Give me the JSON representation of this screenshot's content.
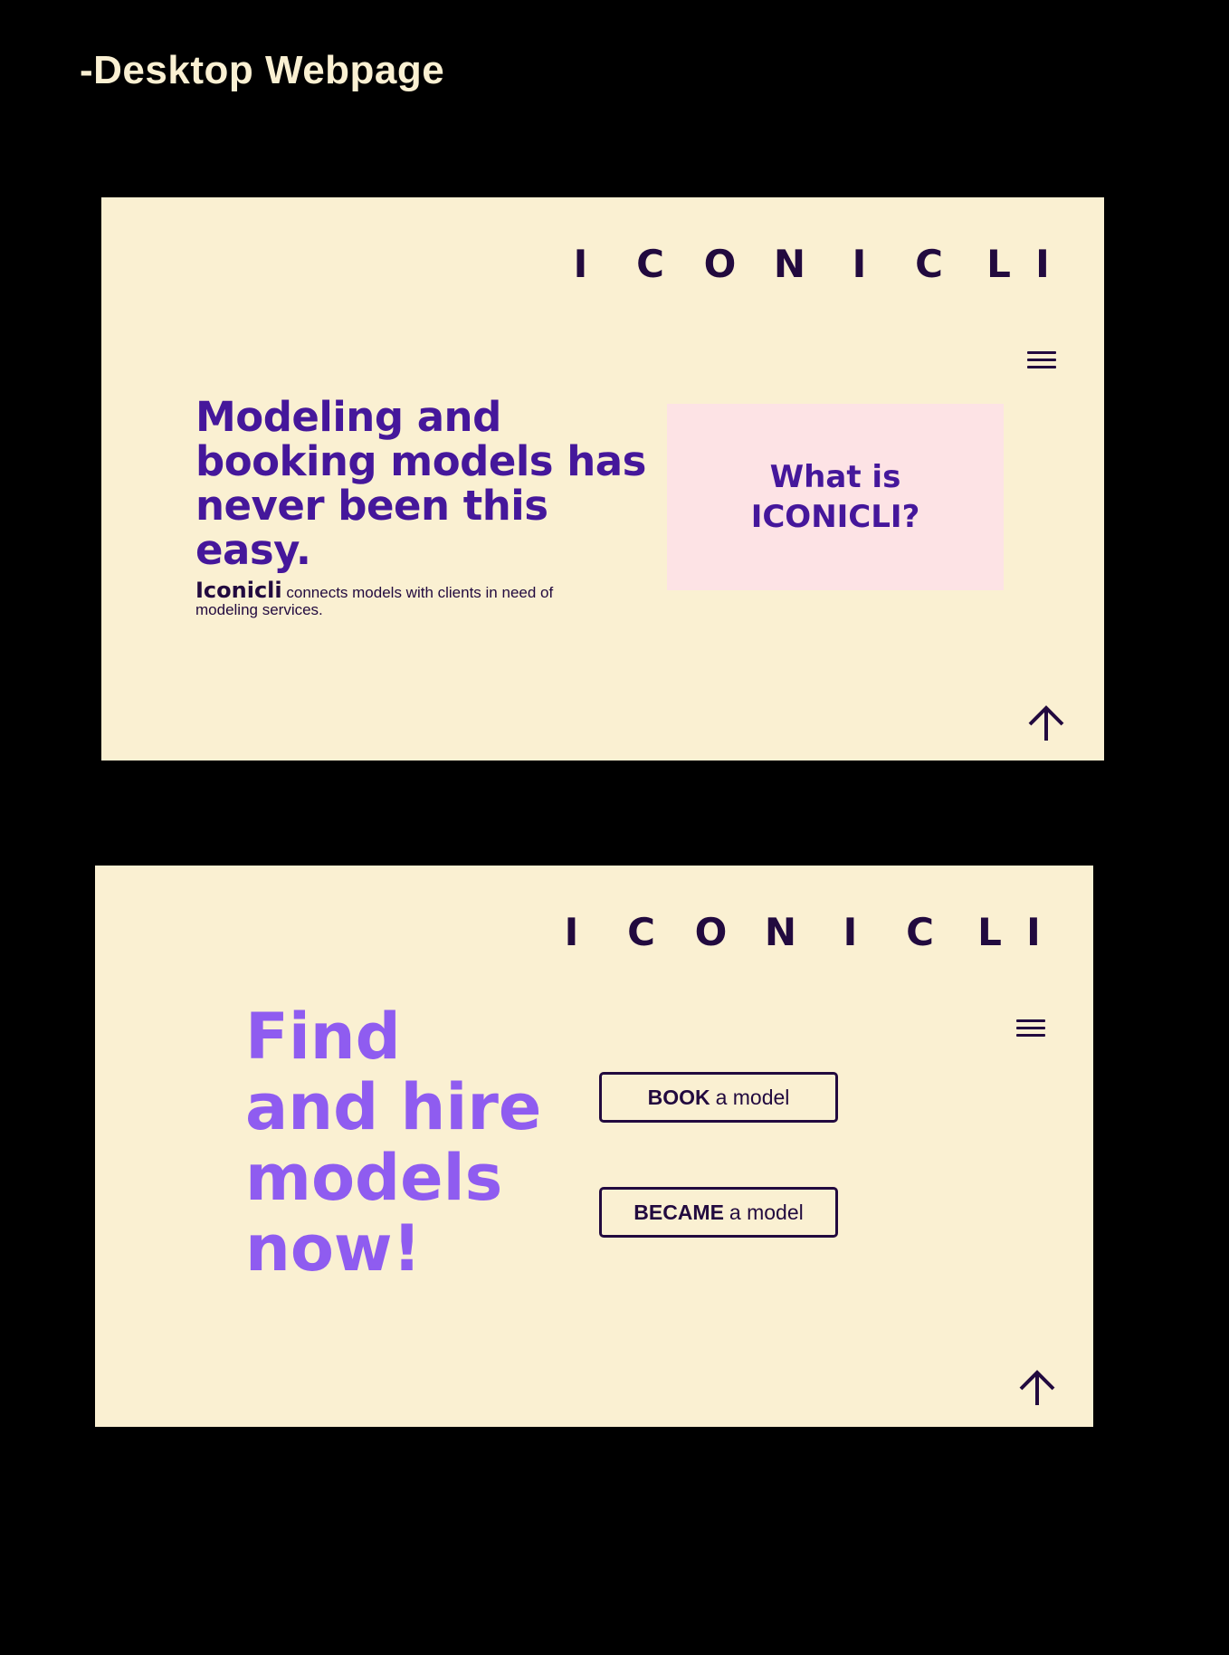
{
  "page": {
    "heading": "-Desktop Webpage"
  },
  "brand": {
    "letters": [
      "I",
      "C",
      "O",
      "N",
      "I",
      "C",
      "L",
      "I"
    ]
  },
  "frame1": {
    "headline": "Modeling and booking models has never been this easy.",
    "description_brand": "Iconicli",
    "description_text": "connects models with clients in need of modeling services.",
    "card_title": "What is\nICONICLI?"
  },
  "frame2": {
    "headline": "Find and hire models now!",
    "book_button": {
      "strong": "BOOK",
      "rest": "a model"
    },
    "become_button": {
      "strong": "BECAME",
      "rest": "a model"
    }
  },
  "icons": {
    "menu": "menu-icon",
    "scroll_top": "up-arrow-icon"
  },
  "colors": {
    "background": "#000000",
    "frame": "#faf0d2",
    "dark_purple": "#220a3f",
    "purple": "#45179b",
    "light_purple": "#8f5cf0",
    "card_pink": "#fde3e5",
    "heading_cream": "#faf0d2"
  }
}
